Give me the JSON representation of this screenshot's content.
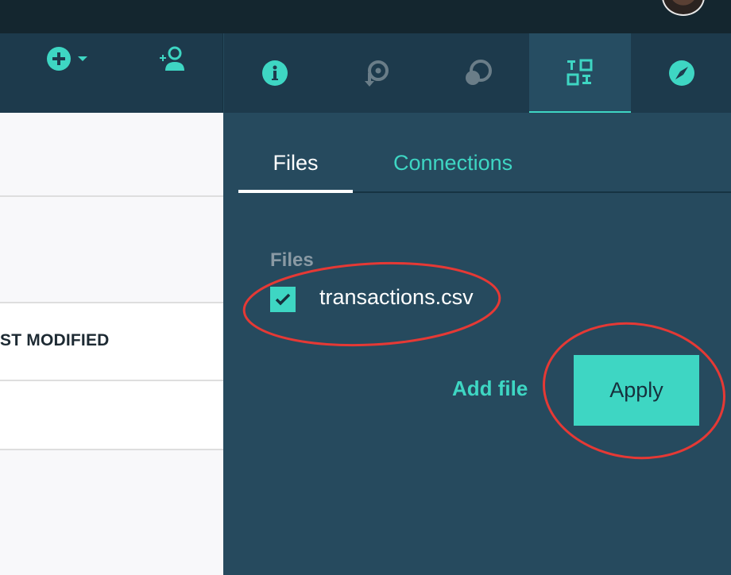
{
  "header": {
    "avatar_alt": "user avatar"
  },
  "left_toolbar": {
    "icons": [
      "add-circle-icon",
      "chevron-down-icon",
      "add-user-icon"
    ]
  },
  "right_toolbar": {
    "icons": [
      "info-icon",
      "history-icon",
      "comments-icon",
      "data-icon",
      "compass-icon"
    ],
    "active_index": 3
  },
  "table": {
    "column_header": "ST MODIFIED"
  },
  "panel": {
    "tabs": [
      {
        "label": "Files",
        "active": true
      },
      {
        "label": "Connections",
        "active": false
      }
    ],
    "section_label": "Files",
    "files": [
      {
        "name": "transactions.csv",
        "checked": true
      }
    ],
    "add_file_label": "Add file",
    "apply_label": "Apply"
  },
  "colors": {
    "accent": "#3ed6c3",
    "panel_bg": "#264a5e",
    "toolbar_bg": "#1d3a4c",
    "annotation": "#e53935"
  }
}
